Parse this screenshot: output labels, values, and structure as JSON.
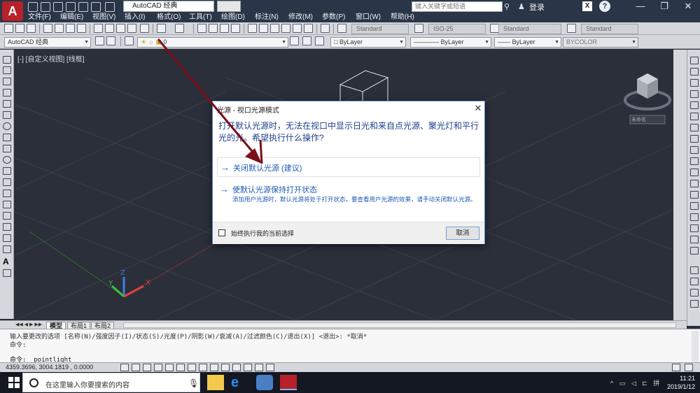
{
  "titlebar": {
    "workspace_combo": "AutoCAD 经典",
    "search_placeholder": "键入关键字或短语",
    "login_label": "登录",
    "help_label": "?",
    "minimize": "—",
    "maximize": "❐",
    "close": "✕"
  },
  "menu": [
    "文件(F)",
    "编辑(E)",
    "视图(V)",
    "插入(I)",
    "格式(O)",
    "工具(T)",
    "绘图(D)",
    "标注(N)",
    "修改(M)",
    "参数(P)",
    "窗口(W)",
    "帮助(H)"
  ],
  "toolbar1": {
    "text_style": "Standard",
    "dim_style": "ISO-25",
    "table_style": "Standard",
    "mleader_style": "Standard"
  },
  "toolbar2": {
    "workspace": "AutoCAD 经典",
    "layer": "0",
    "color": "ByLayer",
    "linetype": "ByLayer",
    "lineweight": "ByLayer",
    "plotstyle": "BYCOLOR"
  },
  "viewport": {
    "label": "[-] [自定义视图] [线框]",
    "viewcube_text": "未命名"
  },
  "tabs": {
    "model": "模型",
    "layout1": "布局1",
    "layout2": "布局2"
  },
  "command": {
    "history_line1": "输入要更改的选项 [名称(N)/强度因子(I)/状态(S)/光度(P)/阴影(W)/衰减(A)/过滤颜色(C)/退出(X)] <退出>: *取消*",
    "history_line2": "命令:",
    "input_line": "命令: _pointlight"
  },
  "status": {
    "coordinates": "4359.3696, 3004.1819 , 0.0000"
  },
  "dialog": {
    "title": "光源 - 视口光源模式",
    "close": "✕",
    "question": "打开默认光源时，无法在视口中显示日光和来自点光源、聚光灯和平行光的光。希望执行什么操作?",
    "option1_arrow": "→",
    "option1_label": "关闭默认光源 (建议)",
    "option2_arrow": "→",
    "option2_label": "使默认光源保持打开状态",
    "option2_desc": "添加用户光源时，默认光源将处于打开状态。要查看用户光源的效果，请手动关闭默认光源。",
    "remember_label": "始终执行我的当前选择",
    "cancel_label": "取消"
  },
  "taskbar": {
    "search_placeholder": "在这里输入你要搜索的内容",
    "time": "11:21",
    "date": "2019/1/12"
  },
  "colors": {
    "titlebar": "#2a3547",
    "viewport_bg": "#2b2f3a",
    "dialog_link": "#1e5bb5",
    "arrow": "#7a0f1a"
  }
}
